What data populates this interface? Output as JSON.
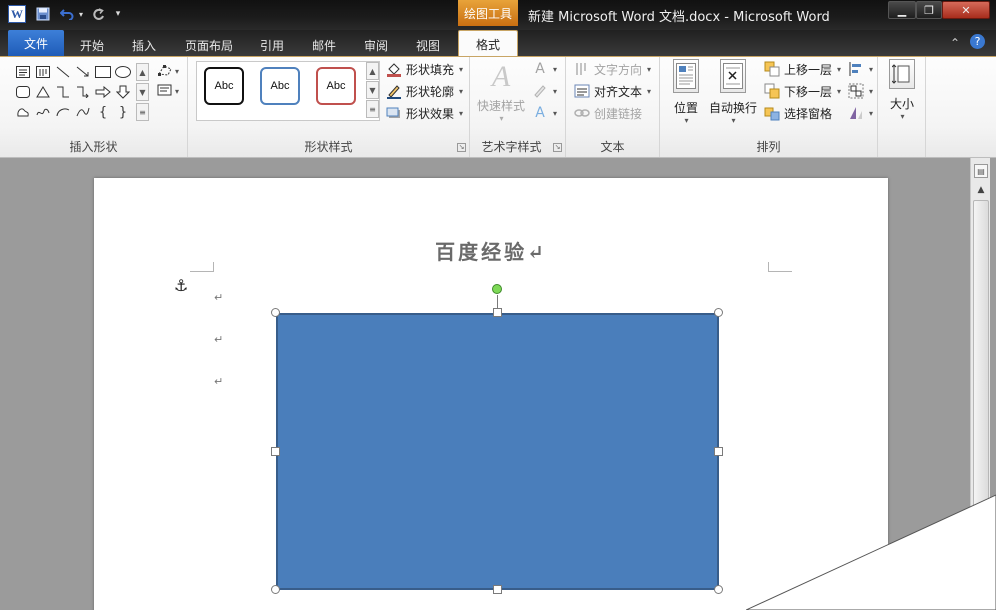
{
  "titlebar": {
    "app_icon_letter": "W",
    "quick_access": [
      "save-icon",
      "undo-icon",
      "redo-icon",
      "customize-icon"
    ],
    "context_tab_title": "绘图工具",
    "window_title": "新建 Microsoft Word 文档.docx - Microsoft Word",
    "window_buttons": [
      "minimize-icon",
      "restore-icon",
      "close-icon"
    ]
  },
  "tabs": {
    "file": "文件",
    "home": "开始",
    "insert": "插入",
    "page_layout": "页面布局",
    "references": "引用",
    "mailings": "邮件",
    "review": "审阅",
    "view": "视图",
    "format": "格式"
  },
  "ribbon": {
    "insert_shapes": {
      "label": "插入形状"
    },
    "shape_styles": {
      "label": "形状样式",
      "presets": [
        {
          "text": "Abc",
          "border": "#111111"
        },
        {
          "text": "Abc",
          "border": "#4f81bd"
        },
        {
          "text": "Abc",
          "border": "#c0504d"
        }
      ],
      "fill": "形状填充",
      "outline": "形状轮廓",
      "effects": "形状效果"
    },
    "wordart": {
      "label": "艺术字样式",
      "quick_styles": "快速样式"
    },
    "text": {
      "label": "文本",
      "direction": "文字方向",
      "align": "对齐文本",
      "create_link": "创建链接"
    },
    "arrange": {
      "label": "排列",
      "position": "位置",
      "wrap": "自动换行",
      "bring_forward": "上移一层",
      "send_backward": "下移一层",
      "selection_pane": "选择窗格"
    },
    "size": {
      "label": "大小"
    }
  },
  "document": {
    "title": "百度经验↵",
    "paragraph_mark": "↵",
    "shape_fill": "#4a7ebb",
    "shape_outline": "#385d8a"
  }
}
